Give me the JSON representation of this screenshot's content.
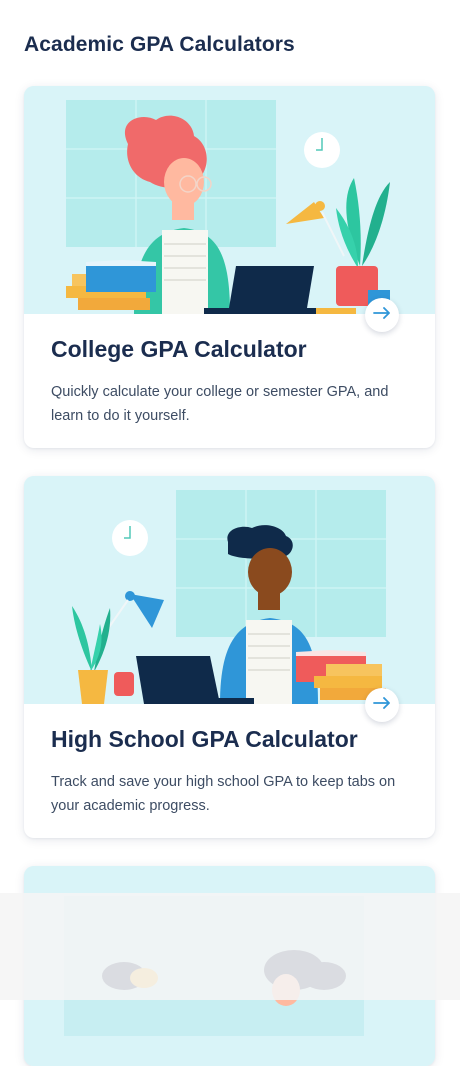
{
  "page": {
    "title": "Academic GPA Calculators"
  },
  "cards": [
    {
      "title": "College GPA Calculator",
      "description": "Quickly calculate your college or semester GPA, and learn to do it yourself.",
      "icon": "arrow-right-icon"
    },
    {
      "title": "High School GPA Calculator",
      "description": "Track and save your high school GPA to keep tabs on your academic progress.",
      "icon": "arrow-right-icon"
    }
  ],
  "colors": {
    "text_primary": "#1b2d4f",
    "text_secondary": "#3d4c63",
    "illustration_bg": "#d9f4f8",
    "accent_blue": "#2f96d8"
  }
}
